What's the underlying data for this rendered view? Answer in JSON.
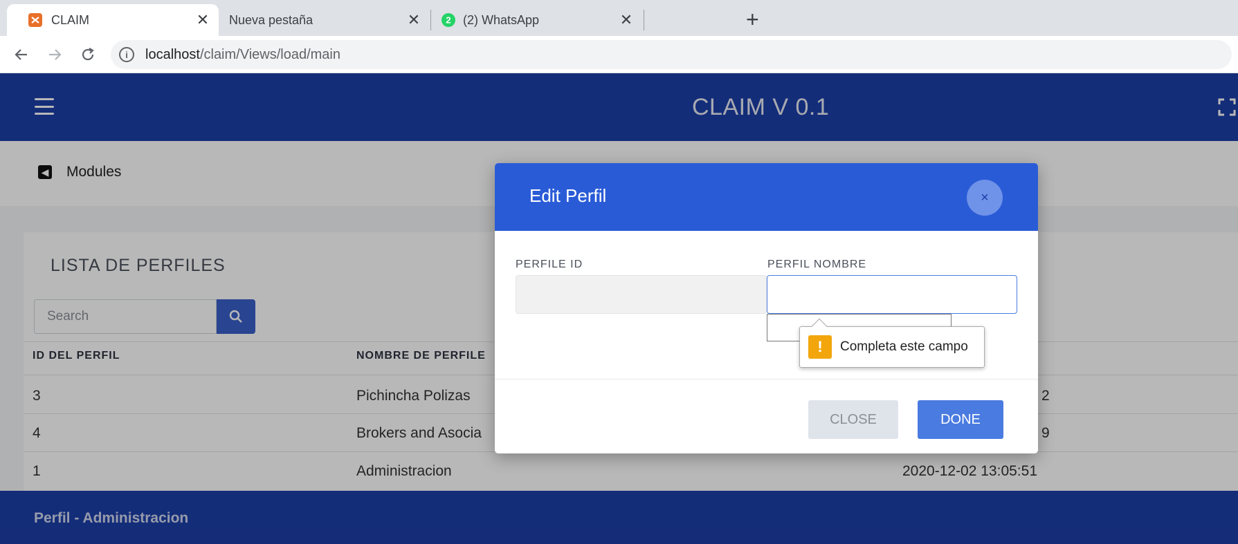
{
  "browser": {
    "tabs": [
      {
        "title": "CLAIM",
        "icon": "xampp-icon",
        "active": true
      },
      {
        "title": "Nueva pestaña",
        "icon": "",
        "active": false
      },
      {
        "title": "(2) WhatsApp",
        "icon": "whatsapp-icon",
        "badge": "2",
        "active": false
      }
    ],
    "close_glyph": "✕",
    "new_tab_glyph": "+",
    "url_host": "localhost",
    "url_path": "/claim/Views/load/main"
  },
  "app": {
    "title": "CLAIM V 0.1",
    "brand_color": "#1d3fa8",
    "breadcrumb": "Modules",
    "card_title": "LISTA DE PERFILES",
    "search_placeholder": "Search",
    "table": {
      "headers": [
        "ID DEL PERFIL",
        "NOMBRE DE PERFILE"
      ],
      "rows": [
        {
          "id": "3",
          "name": "Pichincha Polizas",
          "date": "2"
        },
        {
          "id": "4",
          "name": "Brokers and Asocia",
          "date": "9"
        },
        {
          "id": "1",
          "name": "Administracion",
          "date": "2020-12-02 13:05:51"
        }
      ]
    },
    "footer": "Perfil - Administracion"
  },
  "modal": {
    "title": "Edit Perfil",
    "close_glyph": "×",
    "id_label": "PERFILE ID",
    "id_value": "",
    "name_label": "PERFIL NOMBRE",
    "name_value": "",
    "validation_message": "Completa este campo",
    "warn_glyph": "!",
    "close_button": "CLOSE",
    "done_button": "DONE",
    "header_color": "#2a5bd7"
  }
}
